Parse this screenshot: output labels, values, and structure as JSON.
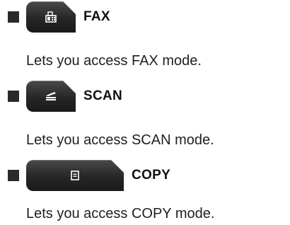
{
  "entries": [
    {
      "mode": "FAX",
      "icon": "fax-icon",
      "description": "Lets you access FAX mode."
    },
    {
      "mode": "SCAN",
      "icon": "scanner-icon",
      "description": "Lets you access SCAN mode."
    },
    {
      "mode": "COPY",
      "icon": "copy-icon",
      "description": "Lets you access COPY mode."
    }
  ],
  "colors": {
    "button": "#2a2a2a",
    "bullet": "#2a2a2a",
    "text": "#1a1a1a"
  }
}
